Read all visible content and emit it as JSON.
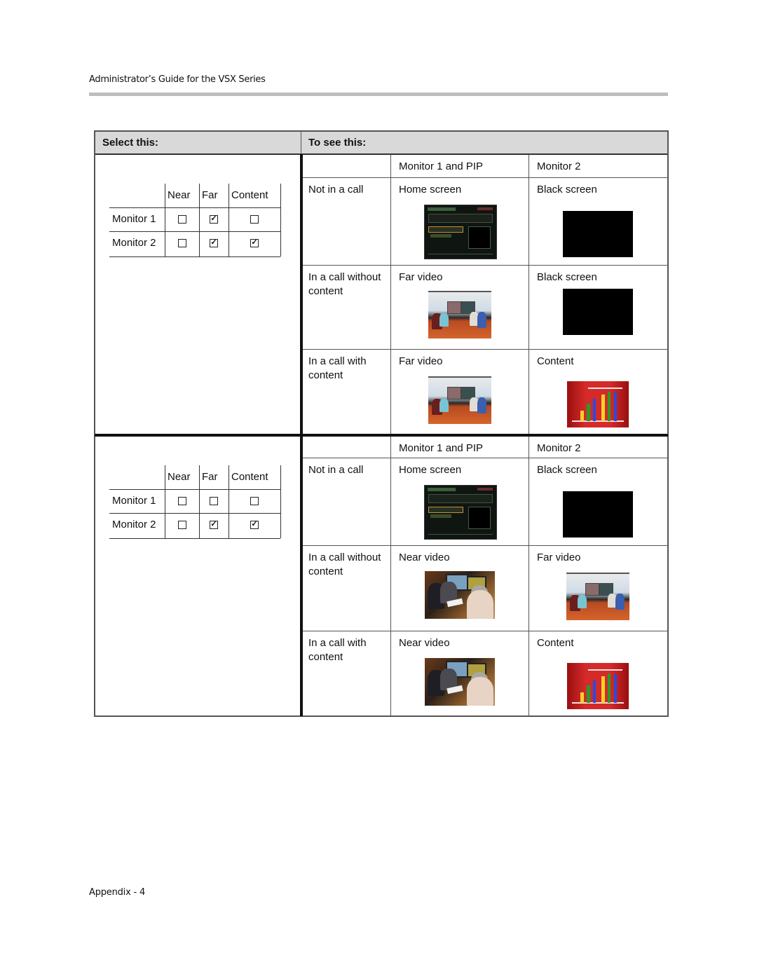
{
  "page": {
    "running_head": "Administrator’s Guide for the VSX Series",
    "footer": "Appendix - 4"
  },
  "table": {
    "headers": {
      "select": "Select this:",
      "see": "To see this:"
    },
    "sections": [
      {
        "selection": {
          "columns": [
            "Near",
            "Far",
            "Content"
          ],
          "rows": [
            {
              "label": "Monitor 1",
              "near": false,
              "far": true,
              "content": false
            },
            {
              "label": "Monitor 2",
              "near": false,
              "far": true,
              "content": true
            }
          ]
        },
        "result_columns": [
          "Monitor 1 and PIP",
          "Monitor 2"
        ],
        "results": [
          {
            "state": "Not in a call",
            "monitor1": {
              "label": "Home screen",
              "image": "home-screen"
            },
            "monitor2": {
              "label": "Black screen",
              "image": "black-screen"
            }
          },
          {
            "state": "In a call without content",
            "monitor1": {
              "label": "Far video",
              "image": "far-video"
            },
            "monitor2": {
              "label": "Black screen",
              "image": "black-screen"
            }
          },
          {
            "state": "In a call with content",
            "monitor1": {
              "label": "Far video",
              "image": "far-video"
            },
            "monitor2": {
              "label": "Content",
              "image": "content-chart"
            }
          }
        ]
      },
      {
        "selection": {
          "columns": [
            "Near",
            "Far",
            "Content"
          ],
          "rows": [
            {
              "label": "Monitor 1",
              "near": false,
              "far": false,
              "content": false
            },
            {
              "label": "Monitor 2",
              "near": false,
              "far": true,
              "content": true
            }
          ]
        },
        "result_columns": [
          "Monitor 1 and PIP",
          "Monitor 2"
        ],
        "results": [
          {
            "state": "Not in a call",
            "monitor1": {
              "label": "Home screen",
              "image": "home-screen"
            },
            "monitor2": {
              "label": "Black screen",
              "image": "black-screen"
            }
          },
          {
            "state": "In a call without content",
            "monitor1": {
              "label": "Near video",
              "image": "near-video"
            },
            "monitor2": {
              "label": "Far video",
              "image": "far-video"
            }
          },
          {
            "state": "In a call with content",
            "monitor1": {
              "label": "Near video",
              "image": "near-video"
            },
            "monitor2": {
              "label": "Content",
              "image": "content-chart"
            }
          }
        ]
      }
    ]
  },
  "colors": {
    "header_bg": "#d9d9d9",
    "rule_gray": "#bdbdbd",
    "content_red": "#d42a2a",
    "bar_yellow": "#f5d02a",
    "bar_green": "#2a9a2a",
    "bar_blue": "#2a4ae0"
  }
}
